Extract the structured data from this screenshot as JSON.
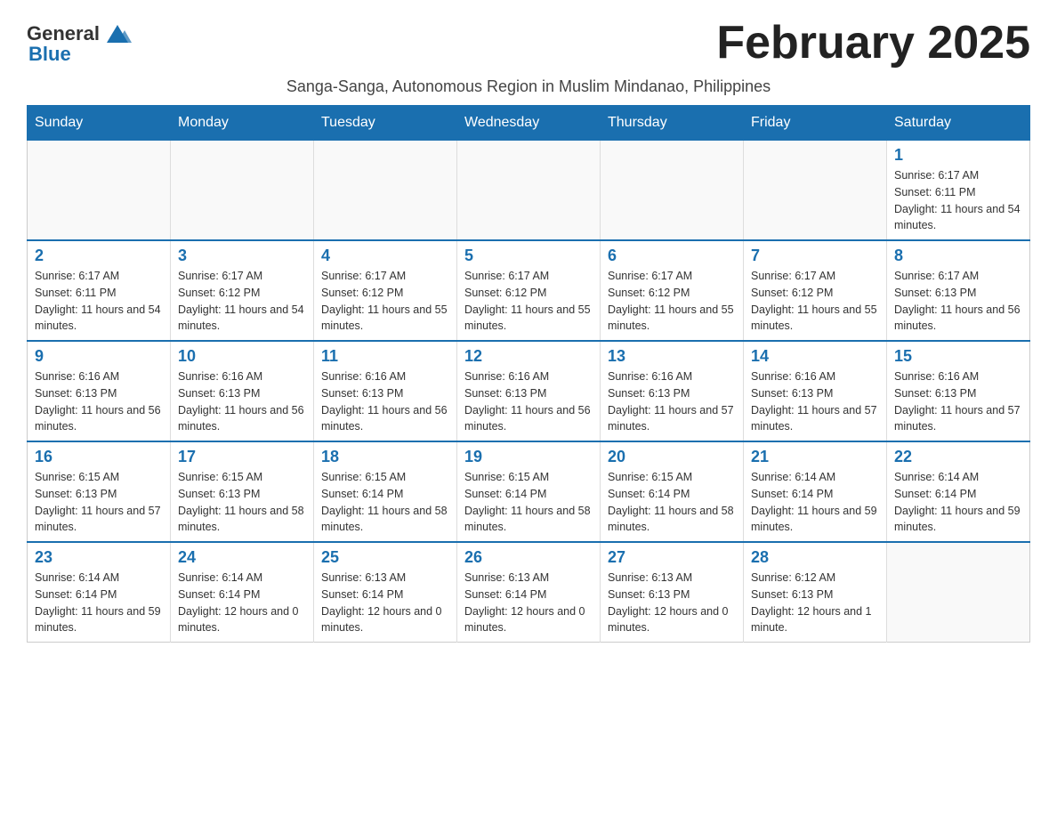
{
  "logo": {
    "text_general": "General",
    "text_blue": "Blue"
  },
  "header": {
    "month_title": "February 2025",
    "subtitle": "Sanga-Sanga, Autonomous Region in Muslim Mindanao, Philippines"
  },
  "days_of_week": [
    "Sunday",
    "Monday",
    "Tuesday",
    "Wednesday",
    "Thursday",
    "Friday",
    "Saturday"
  ],
  "weeks": [
    {
      "days": [
        {
          "number": "",
          "empty": true
        },
        {
          "number": "",
          "empty": true
        },
        {
          "number": "",
          "empty": true
        },
        {
          "number": "",
          "empty": true
        },
        {
          "number": "",
          "empty": true
        },
        {
          "number": "",
          "empty": true
        },
        {
          "number": "1",
          "sunrise": "Sunrise: 6:17 AM",
          "sunset": "Sunset: 6:11 PM",
          "daylight": "Daylight: 11 hours and 54 minutes."
        }
      ]
    },
    {
      "days": [
        {
          "number": "2",
          "sunrise": "Sunrise: 6:17 AM",
          "sunset": "Sunset: 6:11 PM",
          "daylight": "Daylight: 11 hours and 54 minutes."
        },
        {
          "number": "3",
          "sunrise": "Sunrise: 6:17 AM",
          "sunset": "Sunset: 6:12 PM",
          "daylight": "Daylight: 11 hours and 54 minutes."
        },
        {
          "number": "4",
          "sunrise": "Sunrise: 6:17 AM",
          "sunset": "Sunset: 6:12 PM",
          "daylight": "Daylight: 11 hours and 55 minutes."
        },
        {
          "number": "5",
          "sunrise": "Sunrise: 6:17 AM",
          "sunset": "Sunset: 6:12 PM",
          "daylight": "Daylight: 11 hours and 55 minutes."
        },
        {
          "number": "6",
          "sunrise": "Sunrise: 6:17 AM",
          "sunset": "Sunset: 6:12 PM",
          "daylight": "Daylight: 11 hours and 55 minutes."
        },
        {
          "number": "7",
          "sunrise": "Sunrise: 6:17 AM",
          "sunset": "Sunset: 6:12 PM",
          "daylight": "Daylight: 11 hours and 55 minutes."
        },
        {
          "number": "8",
          "sunrise": "Sunrise: 6:17 AM",
          "sunset": "Sunset: 6:13 PM",
          "daylight": "Daylight: 11 hours and 56 minutes."
        }
      ]
    },
    {
      "days": [
        {
          "number": "9",
          "sunrise": "Sunrise: 6:16 AM",
          "sunset": "Sunset: 6:13 PM",
          "daylight": "Daylight: 11 hours and 56 minutes."
        },
        {
          "number": "10",
          "sunrise": "Sunrise: 6:16 AM",
          "sunset": "Sunset: 6:13 PM",
          "daylight": "Daylight: 11 hours and 56 minutes."
        },
        {
          "number": "11",
          "sunrise": "Sunrise: 6:16 AM",
          "sunset": "Sunset: 6:13 PM",
          "daylight": "Daylight: 11 hours and 56 minutes."
        },
        {
          "number": "12",
          "sunrise": "Sunrise: 6:16 AM",
          "sunset": "Sunset: 6:13 PM",
          "daylight": "Daylight: 11 hours and 56 minutes."
        },
        {
          "number": "13",
          "sunrise": "Sunrise: 6:16 AM",
          "sunset": "Sunset: 6:13 PM",
          "daylight": "Daylight: 11 hours and 57 minutes."
        },
        {
          "number": "14",
          "sunrise": "Sunrise: 6:16 AM",
          "sunset": "Sunset: 6:13 PM",
          "daylight": "Daylight: 11 hours and 57 minutes."
        },
        {
          "number": "15",
          "sunrise": "Sunrise: 6:16 AM",
          "sunset": "Sunset: 6:13 PM",
          "daylight": "Daylight: 11 hours and 57 minutes."
        }
      ]
    },
    {
      "days": [
        {
          "number": "16",
          "sunrise": "Sunrise: 6:15 AM",
          "sunset": "Sunset: 6:13 PM",
          "daylight": "Daylight: 11 hours and 57 minutes."
        },
        {
          "number": "17",
          "sunrise": "Sunrise: 6:15 AM",
          "sunset": "Sunset: 6:13 PM",
          "daylight": "Daylight: 11 hours and 58 minutes."
        },
        {
          "number": "18",
          "sunrise": "Sunrise: 6:15 AM",
          "sunset": "Sunset: 6:14 PM",
          "daylight": "Daylight: 11 hours and 58 minutes."
        },
        {
          "number": "19",
          "sunrise": "Sunrise: 6:15 AM",
          "sunset": "Sunset: 6:14 PM",
          "daylight": "Daylight: 11 hours and 58 minutes."
        },
        {
          "number": "20",
          "sunrise": "Sunrise: 6:15 AM",
          "sunset": "Sunset: 6:14 PM",
          "daylight": "Daylight: 11 hours and 58 minutes."
        },
        {
          "number": "21",
          "sunrise": "Sunrise: 6:14 AM",
          "sunset": "Sunset: 6:14 PM",
          "daylight": "Daylight: 11 hours and 59 minutes."
        },
        {
          "number": "22",
          "sunrise": "Sunrise: 6:14 AM",
          "sunset": "Sunset: 6:14 PM",
          "daylight": "Daylight: 11 hours and 59 minutes."
        }
      ]
    },
    {
      "days": [
        {
          "number": "23",
          "sunrise": "Sunrise: 6:14 AM",
          "sunset": "Sunset: 6:14 PM",
          "daylight": "Daylight: 11 hours and 59 minutes."
        },
        {
          "number": "24",
          "sunrise": "Sunrise: 6:14 AM",
          "sunset": "Sunset: 6:14 PM",
          "daylight": "Daylight: 12 hours and 0 minutes."
        },
        {
          "number": "25",
          "sunrise": "Sunrise: 6:13 AM",
          "sunset": "Sunset: 6:14 PM",
          "daylight": "Daylight: 12 hours and 0 minutes."
        },
        {
          "number": "26",
          "sunrise": "Sunrise: 6:13 AM",
          "sunset": "Sunset: 6:14 PM",
          "daylight": "Daylight: 12 hours and 0 minutes."
        },
        {
          "number": "27",
          "sunrise": "Sunrise: 6:13 AM",
          "sunset": "Sunset: 6:13 PM",
          "daylight": "Daylight: 12 hours and 0 minutes."
        },
        {
          "number": "28",
          "sunrise": "Sunrise: 6:12 AM",
          "sunset": "Sunset: 6:13 PM",
          "daylight": "Daylight: 12 hours and 1 minute."
        },
        {
          "number": "",
          "empty": true
        }
      ]
    }
  ]
}
